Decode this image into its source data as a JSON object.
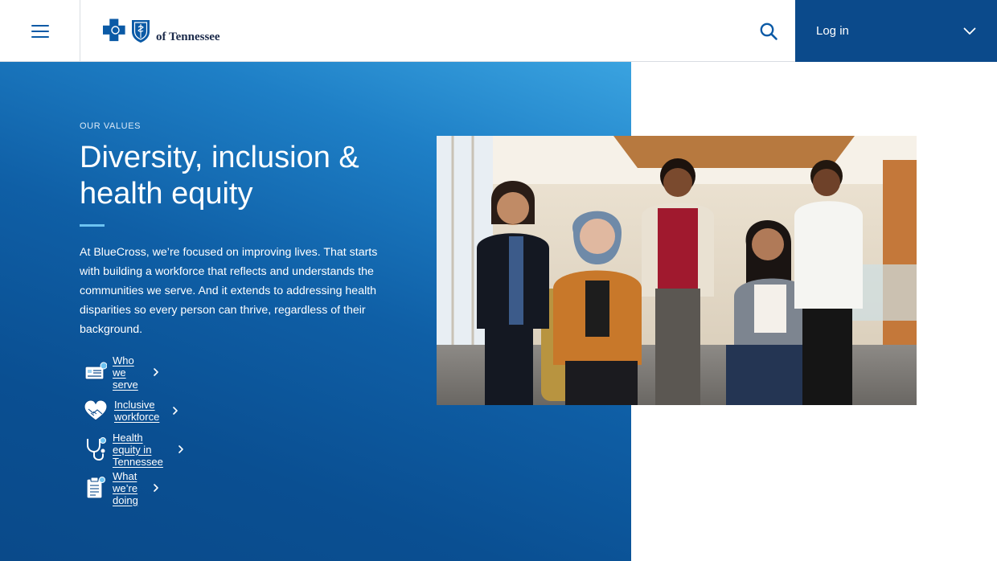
{
  "header": {
    "menu_icon": "hamburger-menu-icon",
    "logo_text": "of Tennessee",
    "search_icon": "search-icon",
    "login_label": "Log in",
    "login_chevron_icon": "chevron-down-icon"
  },
  "hero": {
    "eyebrow": "OUR VALUES",
    "title": "Diversity, inclusion & health equity",
    "intro": "At BlueCross, we’re focused on improving lives. That starts with building a workforce that reflects and understands the communities we serve. And it extends to addressing health disparities so every person can thrive, regardless of their background.",
    "links": [
      {
        "label": "Who we serve",
        "icon": "id-card-icon"
      },
      {
        "label": "Inclusive workforce",
        "icon": "heart-hands-icon"
      },
      {
        "label": "Health equity in Tennessee",
        "icon": "stethoscope-icon"
      },
      {
        "label": "What we’re doing",
        "icon": "clipboard-icon"
      }
    ],
    "photo_description": "team-photo"
  },
  "colors": {
    "brand_dark": "#0b4a8b",
    "brand_blue": "#0b5aa6",
    "accent": "#6cc3f2",
    "hero_light": "#3aa3e0"
  }
}
